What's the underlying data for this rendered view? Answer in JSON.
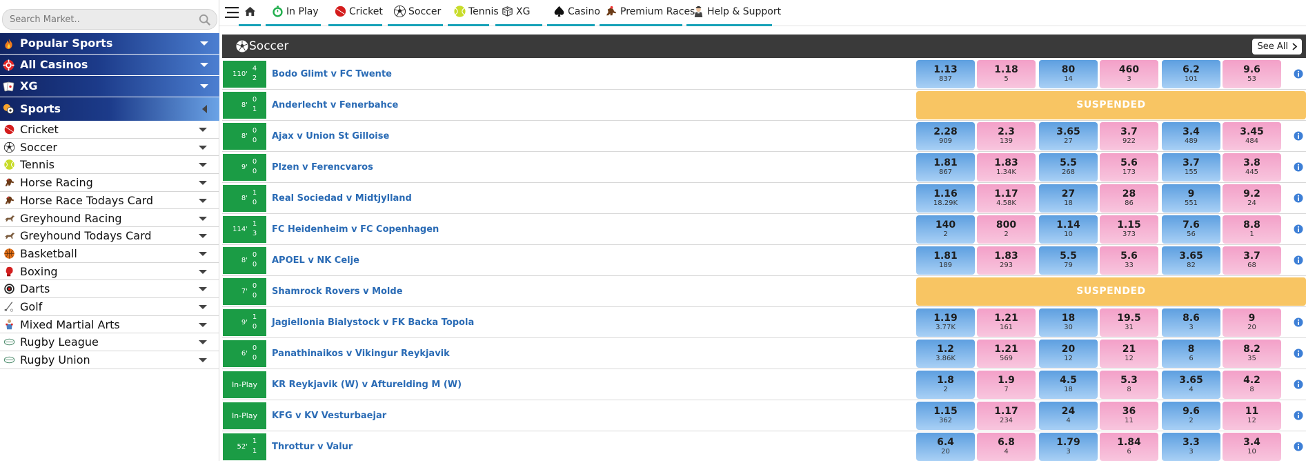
{
  "colors": {
    "category_gradient": [
      "#112463",
      "#4c7fd1"
    ],
    "nav_underline": "#17a2b8",
    "score_bg": "#1b9c45",
    "back": "#7ab6ec",
    "lay": "#f5b2d3",
    "suspended": "#f8c563",
    "section_header": "#3a3a3a",
    "match_link": "#2a6bb5"
  },
  "search": {
    "placeholder": "Search Market..",
    "icon": "search-icon"
  },
  "categories": [
    {
      "label": "Popular Sports",
      "icon": "flame-icon"
    },
    {
      "label": "All Casinos",
      "icon": "casino-chip-icon"
    },
    {
      "label": "XG",
      "icon": "cards-icon"
    },
    {
      "label": "Sports",
      "icon": "sports-balls-icon",
      "expanded": true
    }
  ],
  "sports": [
    {
      "label": "Cricket",
      "icon": "cricket-ball-icon"
    },
    {
      "label": "Soccer",
      "icon": "soccer-ball-icon"
    },
    {
      "label": "Tennis",
      "icon": "tennis-ball-icon"
    },
    {
      "label": "Horse Racing",
      "icon": "horse-icon"
    },
    {
      "label": "Horse Race Todays Card",
      "icon": "horse-icon"
    },
    {
      "label": "Greyhound Racing",
      "icon": "greyhound-icon"
    },
    {
      "label": "Greyhound Todays Card",
      "icon": "greyhound-icon"
    },
    {
      "label": "Basketball",
      "icon": "basketball-icon"
    },
    {
      "label": "Boxing",
      "icon": "boxing-glove-icon"
    },
    {
      "label": "Darts",
      "icon": "dartboard-icon"
    },
    {
      "label": "Golf",
      "icon": "golf-club-icon"
    },
    {
      "label": "Mixed Martial Arts",
      "icon": "fighter-icon"
    },
    {
      "label": "Rugby League",
      "icon": "rugby-ball-icon"
    },
    {
      "label": "Rugby Union",
      "icon": "rugby-ball-icon"
    }
  ],
  "nav": [
    {
      "label": "",
      "icon": "home-icon"
    },
    {
      "label": "In Play",
      "icon": "stopwatch-icon"
    },
    {
      "label": "Cricket",
      "icon": "cricket-ball-icon"
    },
    {
      "label": "Soccer",
      "icon": "soccer-ball-icon"
    },
    {
      "label": "Tennis",
      "icon": "tennis-ball-icon"
    },
    {
      "label": "XG",
      "icon": "dice-icon"
    },
    {
      "label": "Casino",
      "icon": "spade-icon"
    },
    {
      "label": "Premium Races",
      "icon": "jockey-icon"
    },
    {
      "label": "Help & Support",
      "icon": "support-agent-icon"
    }
  ],
  "section": {
    "title": "Soccer",
    "see_all": "See All"
  },
  "matches": [
    {
      "time": "110'",
      "home": "4",
      "away": "2",
      "name": "Bodo Glimt v FC Twente",
      "suspended": false,
      "odds": [
        [
          "1.13",
          "837"
        ],
        [
          "1.18",
          "5"
        ],
        [
          "80",
          "14"
        ],
        [
          "460",
          "3"
        ],
        [
          "6.2",
          "101"
        ],
        [
          "9.6",
          "53"
        ]
      ]
    },
    {
      "time": "8'",
      "home": "0",
      "away": "1",
      "name": "Anderlecht v Fenerbahce",
      "suspended": true,
      "suspended_label": "SUSPENDED",
      "odds": []
    },
    {
      "time": "8'",
      "home": "0",
      "away": "0",
      "name": "Ajax v Union St Gilloise",
      "suspended": false,
      "odds": [
        [
          "2.28",
          "909"
        ],
        [
          "2.3",
          "139"
        ],
        [
          "3.65",
          "27"
        ],
        [
          "3.7",
          "922"
        ],
        [
          "3.4",
          "489"
        ],
        [
          "3.45",
          "484"
        ]
      ]
    },
    {
      "time": "9'",
      "home": "0",
      "away": "0",
      "name": "Plzen v Ferencvaros",
      "suspended": false,
      "odds": [
        [
          "1.81",
          "867"
        ],
        [
          "1.83",
          "1.34K"
        ],
        [
          "5.5",
          "268"
        ],
        [
          "5.6",
          "173"
        ],
        [
          "3.7",
          "155"
        ],
        [
          "3.8",
          "445"
        ]
      ]
    },
    {
      "time": "8'",
      "home": "1",
      "away": "0",
      "name": "Real Sociedad v Midtjylland",
      "suspended": false,
      "odds": [
        [
          "1.16",
          "18.29K"
        ],
        [
          "1.17",
          "4.58K"
        ],
        [
          "27",
          "18"
        ],
        [
          "28",
          "86"
        ],
        [
          "9",
          "551"
        ],
        [
          "9.2",
          "24"
        ]
      ]
    },
    {
      "time": "114'",
      "home": "1",
      "away": "3",
      "name": "FC Heidenheim v FC Copenhagen",
      "suspended": false,
      "odds": [
        [
          "140",
          "2"
        ],
        [
          "800",
          "2"
        ],
        [
          "1.14",
          "10"
        ],
        [
          "1.15",
          "373"
        ],
        [
          "7.6",
          "56"
        ],
        [
          "8.8",
          "1"
        ]
      ]
    },
    {
      "time": "8'",
      "home": "0",
      "away": "0",
      "name": "APOEL v NK Celje",
      "suspended": false,
      "odds": [
        [
          "1.81",
          "189"
        ],
        [
          "1.83",
          "293"
        ],
        [
          "5.5",
          "79"
        ],
        [
          "5.6",
          "33"
        ],
        [
          "3.65",
          "82"
        ],
        [
          "3.7",
          "68"
        ]
      ]
    },
    {
      "time": "7'",
      "home": "0",
      "away": "0",
      "name": "Shamrock Rovers v Molde",
      "suspended": true,
      "suspended_label": "SUSPENDED",
      "odds": []
    },
    {
      "time": "9'",
      "home": "1",
      "away": "0",
      "name": "Jagiellonia Bialystock v FK Backa Topola",
      "suspended": false,
      "odds": [
        [
          "1.19",
          "3.77K"
        ],
        [
          "1.21",
          "161"
        ],
        [
          "18",
          "30"
        ],
        [
          "19.5",
          "31"
        ],
        [
          "8.6",
          "3"
        ],
        [
          "9",
          "20"
        ]
      ]
    },
    {
      "time": "6'",
      "home": "0",
      "away": "0",
      "name": "Panathinaikos v Vikingur Reykjavik",
      "suspended": false,
      "odds": [
        [
          "1.2",
          "3.86K"
        ],
        [
          "1.21",
          "569"
        ],
        [
          "20",
          "12"
        ],
        [
          "21",
          "12"
        ],
        [
          "8",
          "6"
        ],
        [
          "8.2",
          "35"
        ]
      ]
    },
    {
      "time": "",
      "inplay_label": "In-Play",
      "home": "",
      "away": "",
      "name": "KR Reykjavik (W) v Afturelding M (W)",
      "suspended": false,
      "odds": [
        [
          "1.8",
          "2"
        ],
        [
          "1.9",
          "7"
        ],
        [
          "4.5",
          "18"
        ],
        [
          "5.3",
          "8"
        ],
        [
          "3.65",
          "4"
        ],
        [
          "4.2",
          "8"
        ]
      ]
    },
    {
      "time": "",
      "inplay_label": "In-Play",
      "home": "",
      "away": "",
      "name": "KFG v KV Vesturbaejar",
      "suspended": false,
      "odds": [
        [
          "1.15",
          "362"
        ],
        [
          "1.17",
          "234"
        ],
        [
          "24",
          "4"
        ],
        [
          "36",
          "11"
        ],
        [
          "9.6",
          "2"
        ],
        [
          "11",
          "12"
        ]
      ]
    },
    {
      "time": "52'",
      "home": "1",
      "away": "1",
      "name": "Throttur v Valur",
      "suspended": false,
      "odds": [
        [
          "6.4",
          "20"
        ],
        [
          "6.8",
          "4"
        ],
        [
          "1.79",
          "3"
        ],
        [
          "1.84",
          "6"
        ],
        [
          "3.3",
          "3"
        ],
        [
          "3.4",
          "10"
        ]
      ]
    }
  ]
}
